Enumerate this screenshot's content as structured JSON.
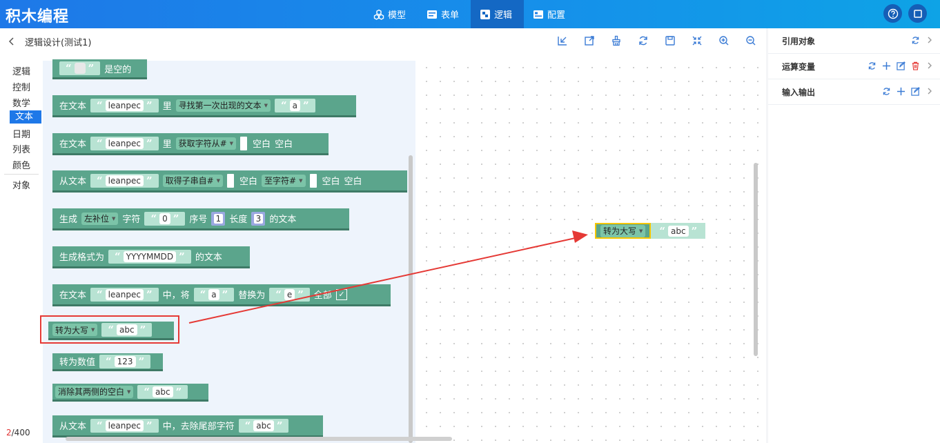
{
  "app": {
    "title": "积木编程"
  },
  "nav": {
    "model": "模型",
    "form": "表单",
    "logic": "逻辑",
    "config": "配置"
  },
  "subheader": {
    "title": "逻辑设计(测试1)"
  },
  "categories": [
    "逻辑",
    "控制",
    "数学",
    "文本",
    "日期",
    "列表",
    "颜色",
    "对象"
  ],
  "counter": {
    "current": "2",
    "total": "/400"
  },
  "right_panel": {
    "items": [
      "引用对象",
      "运算变量",
      "输入输出"
    ]
  },
  "blocks": {
    "b0": {
      "text": "是空的",
      "str": ""
    },
    "b1": {
      "t1": "在文本",
      "s1": "leanpec",
      "t2": "里",
      "dd": "寻找第一次出现的文本",
      "s2": "a"
    },
    "b2": {
      "t1": "在文本",
      "s1": "leanpec",
      "t2": "里",
      "dd": "获取字符从#",
      "t3": "空白",
      "t4": "空白"
    },
    "b3": {
      "t1": "从文本",
      "s1": "leanpec",
      "dd1": "取得子串自#",
      "t2": "空白",
      "dd2": "至字符#",
      "t3": "空白",
      "t4": "空白"
    },
    "b4": {
      "t1": "生成",
      "dd": "左补位",
      "t2": "字符",
      "s1": "0",
      "t3": "序号",
      "n1": "1",
      "t4": "长度",
      "n2": "3",
      "t5": "的文本"
    },
    "b5": {
      "t1": "生成格式为",
      "s1": "YYYYMMDD",
      "t2": "的文本"
    },
    "b6": {
      "t1": "在文本",
      "s1": "leanpec",
      "t2": "中，将",
      "s2": "a",
      "t3": "替换为",
      "s3": "e",
      "t4": "全部"
    },
    "b7": {
      "dd": "转为大写",
      "s1": "abc"
    },
    "b8": {
      "t1": "转为数值",
      "s1": "123"
    },
    "b9": {
      "dd": "消除其两侧的空白",
      "s1": "abc"
    },
    "b10": {
      "t1": "从文本",
      "s1": "leanpec",
      "t2": "中，去除尾部字符",
      "s2": "abc"
    }
  },
  "workspace_block": {
    "dd": "转为大写",
    "s1": "abc"
  },
  "icons": [
    "cube-icon",
    "form-icon",
    "logic-icon",
    "config-icon",
    "help-icon",
    "fullscreen-icon",
    "back-icon",
    "import-icon",
    "export-icon",
    "clean-icon",
    "refresh-icon",
    "save-icon",
    "collapse-icon",
    "zoom-in-icon",
    "zoom-out-icon",
    "add-icon",
    "edit-icon",
    "delete-icon",
    "chevron-right-icon"
  ],
  "colors": {
    "topbar": "#1e78e8",
    "block": "#5ba58c",
    "string_slot": "#b8e3d3",
    "highlight": "#e53935",
    "selected_outline": "#f4c600"
  }
}
